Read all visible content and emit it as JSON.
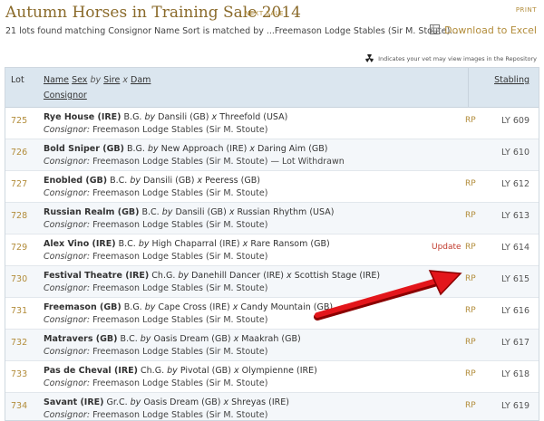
{
  "header": {
    "title": "Autumn Horses in Training Sale 2014",
    "next_sale": "NEXT SALE",
    "print": "PRINT"
  },
  "summary": "21 lots found matching Consignor Name Sort is matched by ...Freemason Lodge Stables (Sir M. Stoute)...",
  "download_label": "Download to Excel",
  "legend_text": "Indicates your vet may view images in the Repository",
  "table": {
    "headers": {
      "lot": "Lot",
      "name": "Name",
      "sex": "Sex",
      "by": "by",
      "sire": "Sire",
      "x": "x",
      "dam": "Dam",
      "consignor": "Consignor",
      "stabling": "Stabling"
    },
    "rows": [
      {
        "lot": "725",
        "horse": "Rye House (IRE)",
        "sex": "B.G.",
        "sire": "Dansili (GB)",
        "dam": "Threefold (USA)",
        "consignor": "Freemason Lodge Stables (Sir M. Stoute)",
        "note": "",
        "update": "",
        "rp": "RP",
        "stabling": "LY  609"
      },
      {
        "lot": "726",
        "horse": "Bold Sniper (GB)",
        "sex": "B.G.",
        "sire": "New Approach (IRE)",
        "dam": "Daring Aim (GB)",
        "consignor": "Freemason Lodge Stables (Sir M. Stoute)",
        "note": " — Lot Withdrawn",
        "update": "",
        "rp": "",
        "stabling": "LY  610"
      },
      {
        "lot": "727",
        "horse": "Enobled (GB)",
        "sex": "B.C.",
        "sire": "Dansili (GB)",
        "dam": "Peeress (GB)",
        "consignor": "Freemason Lodge Stables (Sir M. Stoute)",
        "note": "",
        "update": "",
        "rp": "RP",
        "stabling": "LY  612"
      },
      {
        "lot": "728",
        "horse": "Russian Realm (GB)",
        "sex": "B.C.",
        "sire": "Dansili (GB)",
        "dam": "Russian Rhythm (USA)",
        "consignor": "Freemason Lodge Stables (Sir M. Stoute)",
        "note": "",
        "update": "",
        "rp": "RP",
        "stabling": "LY  613"
      },
      {
        "lot": "729",
        "horse": "Alex Vino (IRE)",
        "sex": "B.C.",
        "sire": "High Chaparral (IRE)",
        "dam": "Rare Ransom (GB)",
        "consignor": "Freemason Lodge Stables (Sir M. Stoute)",
        "note": "",
        "update": "Update",
        "rp": "RP",
        "stabling": "LY  614"
      },
      {
        "lot": "730",
        "horse": "Festival Theatre (IRE)",
        "sex": "Ch.G.",
        "sire": "Danehill Dancer (IRE)",
        "dam": "Scottish Stage (IRE)",
        "consignor": "Freemason Lodge Stables (Sir M. Stoute)",
        "note": "",
        "update": "",
        "rp": "RP",
        "stabling": "LY  615"
      },
      {
        "lot": "731",
        "horse": "Freemason (GB)",
        "sex": "B.G.",
        "sire": "Cape Cross (IRE)",
        "dam": "Candy Mountain (GB)",
        "consignor": "Freemason Lodge Stables (Sir M. Stoute)",
        "note": "",
        "update": "",
        "rp": "RP",
        "stabling": "LY  616"
      },
      {
        "lot": "732",
        "horse": "Matravers (GB)",
        "sex": "B.C.",
        "sire": "Oasis Dream (GB)",
        "dam": "Maakrah (GB)",
        "consignor": "Freemason Lodge Stables (Sir M. Stoute)",
        "note": "",
        "update": "",
        "rp": "RP",
        "stabling": "LY  617"
      },
      {
        "lot": "733",
        "horse": "Pas de Cheval (IRE)",
        "sex": "Ch.G.",
        "sire": "Pivotal (GB)",
        "dam": "Olympienne (IRE)",
        "consignor": "Freemason Lodge Stables (Sir M. Stoute)",
        "note": "",
        "update": "",
        "rp": "RP",
        "stabling": "LY  618"
      },
      {
        "lot": "734",
        "horse": "Savant (IRE)",
        "sex": "Gr.C.",
        "sire": "Oasis Dream (GB)",
        "dam": "Shreyas (IRE)",
        "consignor": "Freemason Lodge Stables (Sir M. Stoute)",
        "note": "",
        "update": "",
        "rp": "RP",
        "stabling": "LY  619"
      }
    ]
  },
  "labels": {
    "by": "by",
    "x": "x",
    "consignor_prefix": "Consignor:"
  },
  "colors": {
    "accent": "#b28c3a",
    "header_bg": "#dbe6ef",
    "alt_row_bg": "#f4f7fa",
    "update": "#c0392b",
    "arrow": "#e3161b"
  },
  "icons": {
    "download": "excel-icon",
    "legend": "radiation-icon"
  }
}
